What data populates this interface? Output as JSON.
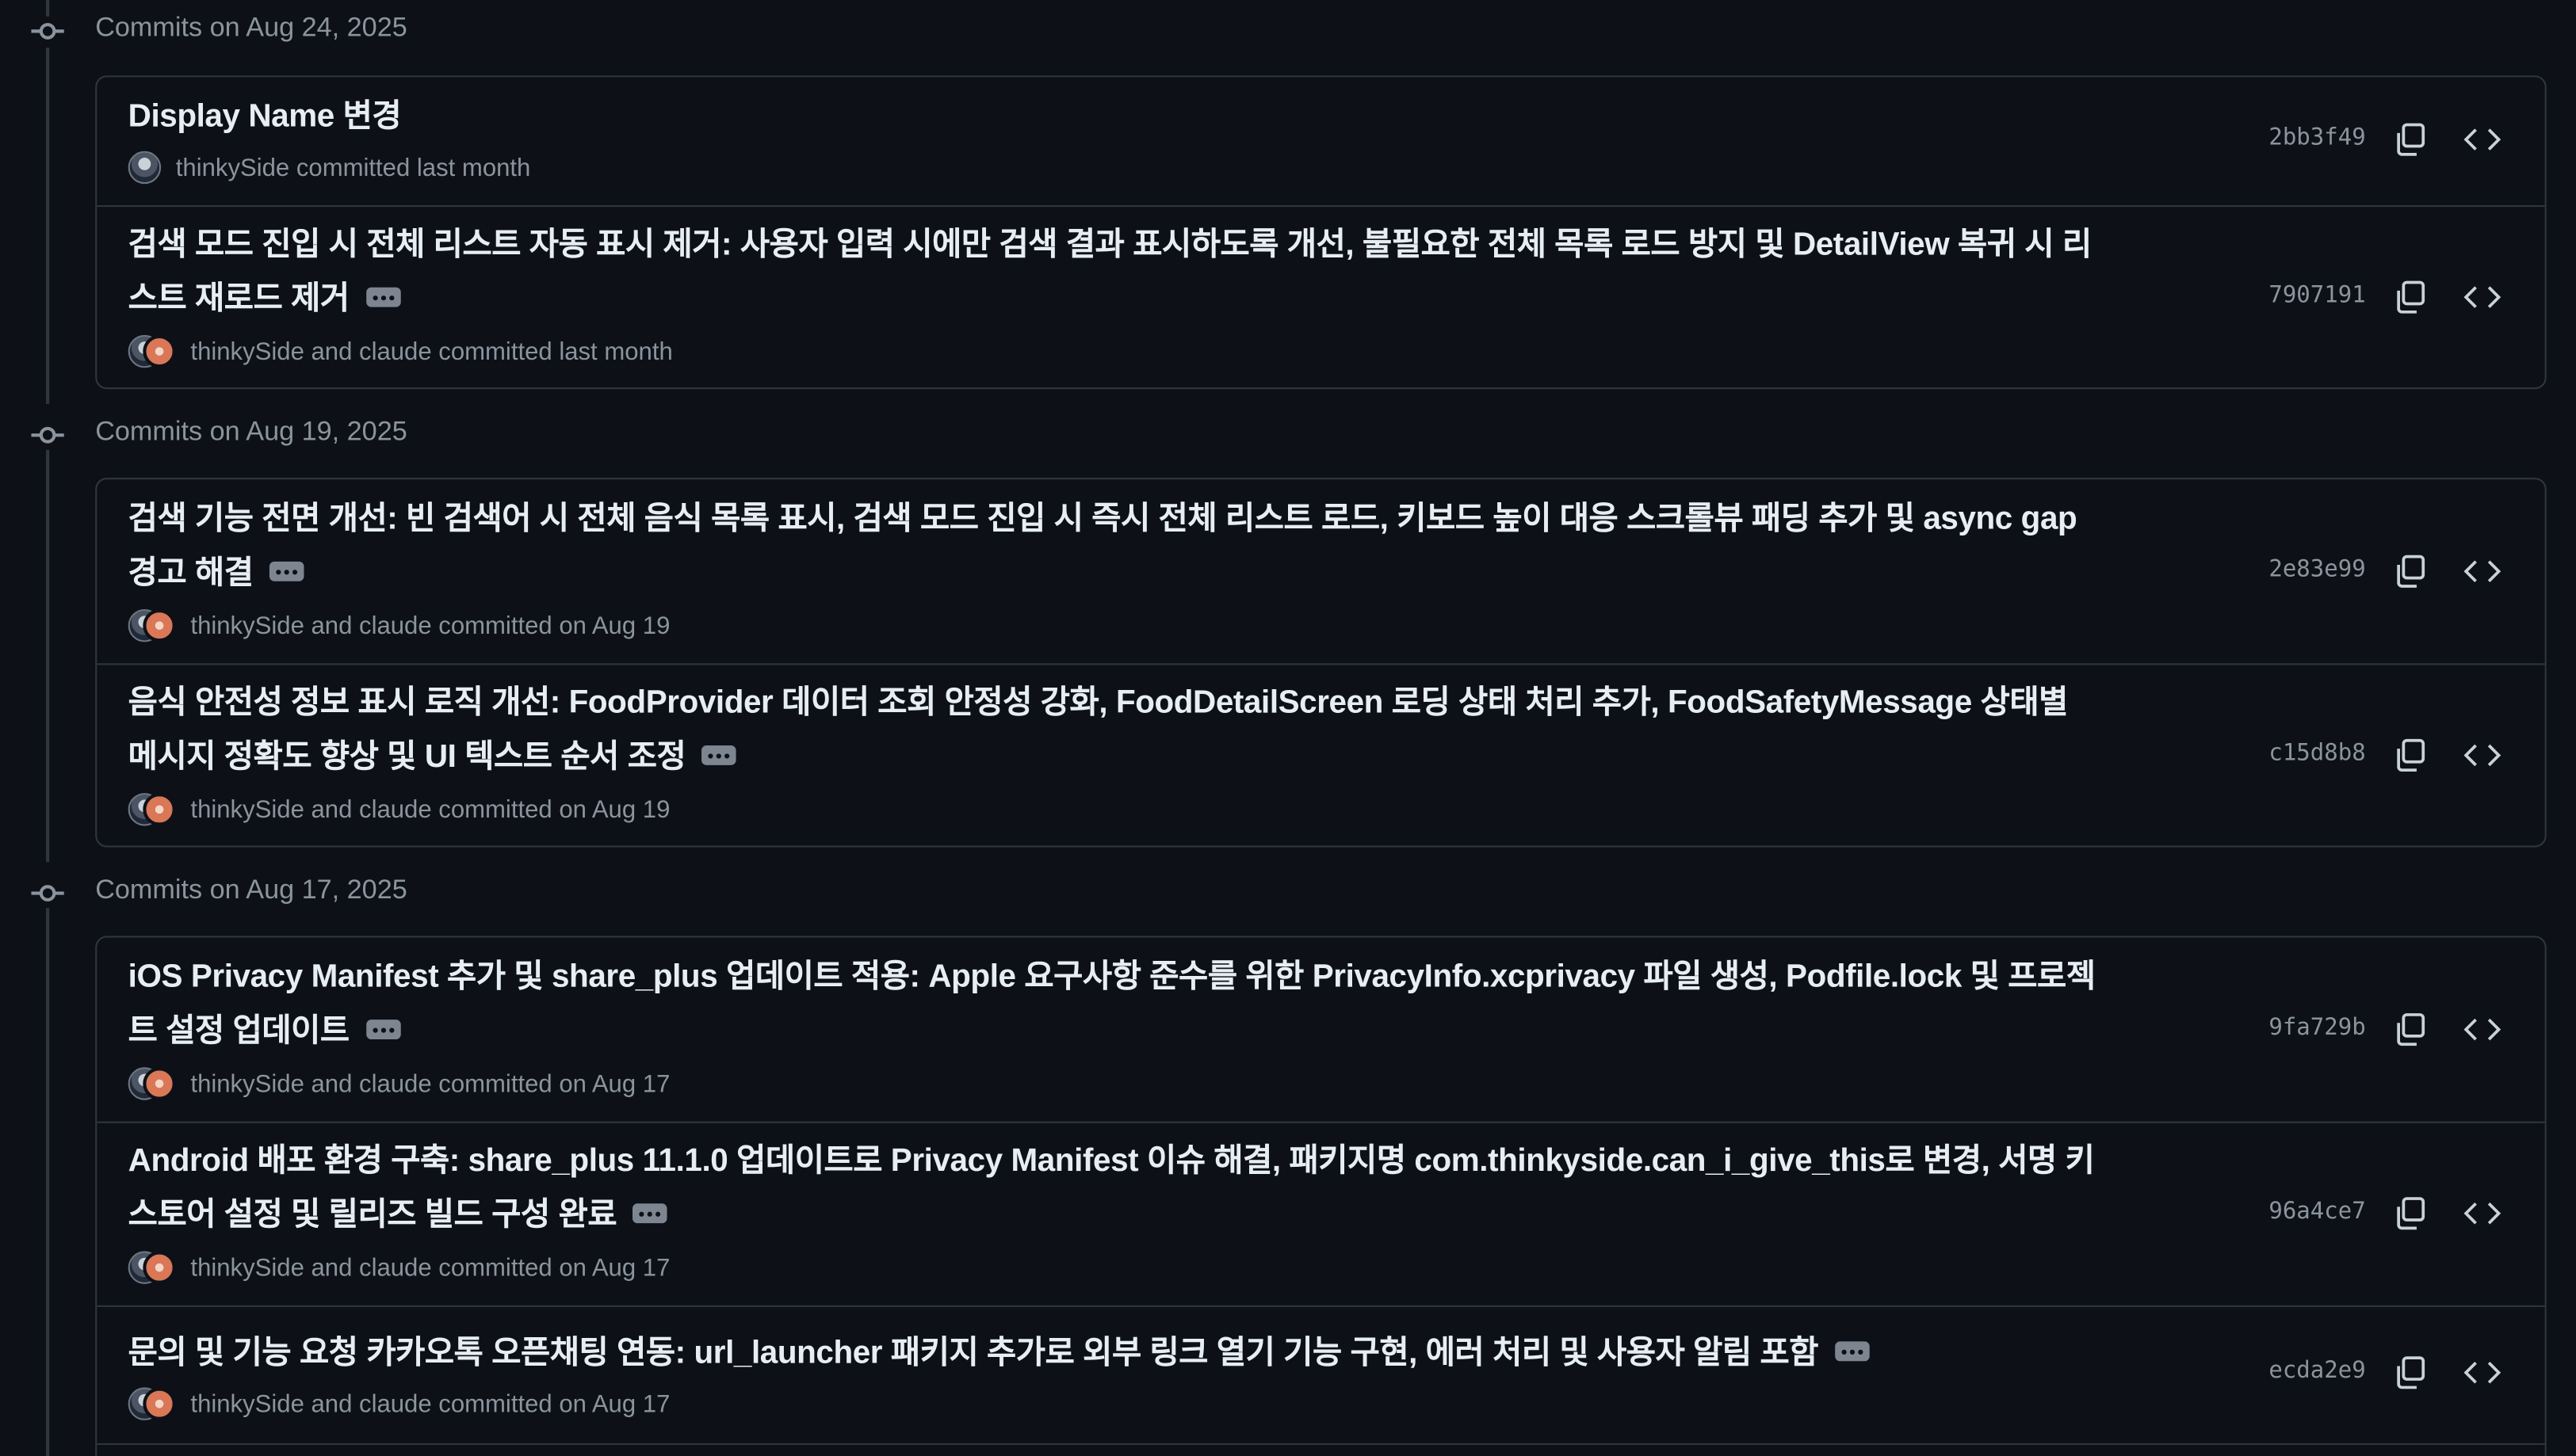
{
  "colors": {
    "background": "#0d1117",
    "border": "#30363d",
    "text_primary": "#e6edf3",
    "text_muted": "#8b949e"
  },
  "groups": [
    {
      "date_label": "Commits on Aug 24, 2025",
      "commits": [
        {
          "message": "Display Name 변경",
          "has_ellipsis": false,
          "author_line": "thinkySide committed last month",
          "co_authored": false,
          "sha": "2bb3f49"
        },
        {
          "message": "검색 모드 진입 시 전체 리스트 자동 표시 제거: 사용자 입력 시에만 검색 결과 표시하도록 개선, 불필요한 전체 목록 로드 방지 및 DetailView 복귀 시 리스트 재로드 제거",
          "has_ellipsis": true,
          "author_line": "thinkySide and claude committed last month",
          "co_authored": true,
          "sha": "7907191"
        }
      ]
    },
    {
      "date_label": "Commits on Aug 19, 2025",
      "commits": [
        {
          "message": "검색 기능 전면 개선: 빈 검색어 시 전체 음식 목록 표시, 검색 모드 진입 시 즉시 전체 리스트 로드, 키보드 높이 대응 스크롤뷰 패딩 추가 및 async gap 경고 해결",
          "has_ellipsis": true,
          "author_line": "thinkySide and claude committed on Aug 19",
          "co_authored": true,
          "sha": "2e83e99"
        },
        {
          "message": "음식 안전성 정보 표시 로직 개선: FoodProvider 데이터 조회 안정성 강화, FoodDetailScreen 로딩 상태 처리 추가, FoodSafetyMessage 상태별 메시지 정확도 향상 및 UI 텍스트 순서 조정",
          "has_ellipsis": true,
          "author_line": "thinkySide and claude committed on Aug 19",
          "co_authored": true,
          "sha": "c15d8b8"
        }
      ]
    },
    {
      "date_label": "Commits on Aug 17, 2025",
      "commits": [
        {
          "message": "iOS Privacy Manifest 추가 및 share_plus 업데이트 적용: Apple 요구사항 준수를 위한 PrivacyInfo.xcprivacy 파일 생성, Podfile.lock 및 프로젝트 설정 업데이트",
          "has_ellipsis": true,
          "author_line": "thinkySide and claude committed on Aug 17",
          "co_authored": true,
          "sha": "9fa729b"
        },
        {
          "message": "Android 배포 환경 구축: share_plus 11.1.0 업데이트로 Privacy Manifest 이슈 해결, 패키지명 com.thinkyside.can_i_give_this로 변경, 서명 키스토어 설정 및 릴리즈 빌드 구성 완료",
          "has_ellipsis": true,
          "author_line": "thinkySide and claude committed on Aug 17",
          "co_authored": true,
          "sha": "96a4ce7"
        },
        {
          "message": "문의 및 기능 요청 카카오톡 오픈채팅 연동: url_launcher 패키지 추가로 외부 링크 열기 기능 구현, 에러 처리 및 사용자 알림 포함",
          "has_ellipsis": true,
          "author_line": "thinkySide and claude committed on Aug 17",
          "co_authored": true,
          "sha": "ecda2e9"
        }
      ]
    }
  ],
  "icons": {
    "timeline_node": "git-commit-icon",
    "copy": "copy-icon",
    "browse": "code-icon",
    "expand": "ellipsis-icon"
  }
}
